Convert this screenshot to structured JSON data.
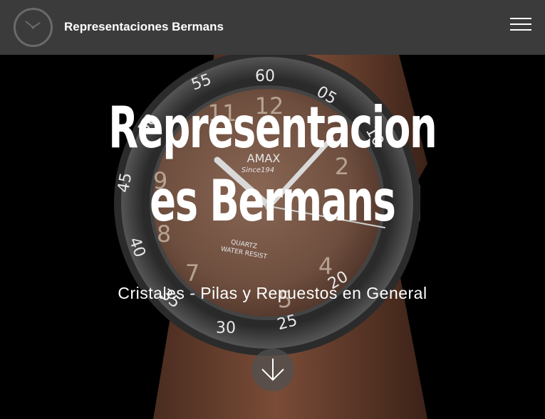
{
  "navbar": {
    "brand": "Representaciones Bermans",
    "logo_icon": "clock-icon",
    "menu_icon": "hamburger-menu-icon"
  },
  "hero": {
    "title_line1": "Representacion",
    "title_line2": "es Bermans",
    "subtitle": "Cristales - Pilas y Repuestos en General",
    "scroll_icon": "arrow-down-icon"
  },
  "watch": {
    "bezel_numbers": [
      "60",
      "05",
      "10",
      "20",
      "25",
      "30",
      "35",
      "40",
      "45",
      "50",
      "55"
    ],
    "dial_numbers": [
      "12",
      "2",
      "4",
      "5",
      "7",
      "8",
      "9",
      "11"
    ],
    "brand_text": "AMAX",
    "since_text": "Since194",
    "movement_text": "QUARTZ",
    "resist_text": "WATER RESIST"
  },
  "colors": {
    "navbar_bg": "#3b3b3b",
    "page_bg": "#000000",
    "text": "#ffffff",
    "strap": "#6b4230",
    "dial": "#7a5a48"
  }
}
